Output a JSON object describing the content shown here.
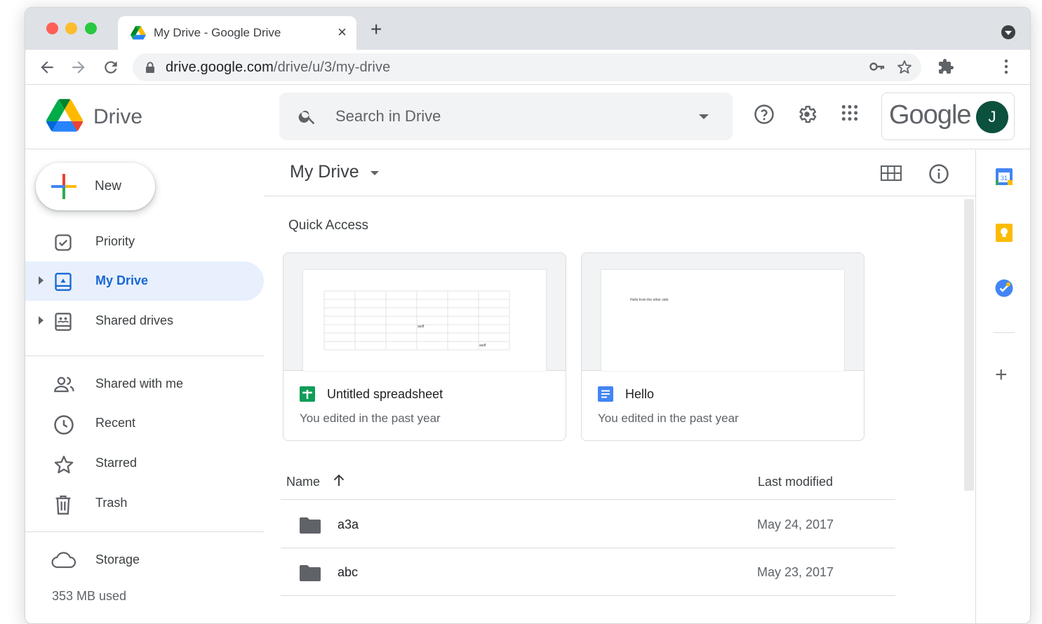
{
  "browser": {
    "tab_title": "My Drive - Google Drive",
    "url_host": "drive.google.com",
    "url_path": "/drive/u/3/my-drive"
  },
  "header": {
    "app_name": "Drive",
    "search_placeholder": "Search in Drive",
    "brand": "Google",
    "avatar_initial": "J"
  },
  "sidebar": {
    "new_label": "New",
    "items": [
      {
        "label": "Priority",
        "icon": "priority-icon"
      },
      {
        "label": "My Drive",
        "icon": "my-drive-icon",
        "active": true
      },
      {
        "label": "Shared drives",
        "icon": "shared-drives-icon"
      },
      {
        "label": "Shared with me",
        "icon": "shared-with-me-icon"
      },
      {
        "label": "Recent",
        "icon": "clock-icon"
      },
      {
        "label": "Starred",
        "icon": "star-icon"
      },
      {
        "label": "Trash",
        "icon": "trash-icon"
      },
      {
        "label": "Storage",
        "icon": "cloud-icon"
      }
    ],
    "storage_used": "353 MB used"
  },
  "main": {
    "title": "My Drive",
    "quick_access_title": "Quick Access",
    "cards": [
      {
        "name": "Untitled spreadsheet",
        "subtitle": "You edited in the past year",
        "type": "sheets",
        "preview_cells": [
          "asdf",
          "asdf"
        ]
      },
      {
        "name": "Hello",
        "subtitle": "You edited in the past year",
        "type": "docs",
        "preview_text": "Hello from the other side"
      }
    ],
    "columns": {
      "name": "Name",
      "modified": "Last modified"
    },
    "rows": [
      {
        "name": "a3a",
        "modified": "May 24, 2017"
      },
      {
        "name": "abc",
        "modified": "May 23, 2017"
      }
    ]
  },
  "side_panel": {
    "calendar_day": "31"
  },
  "colors": {
    "accent_blue": "#1a73e8",
    "active_bg": "#e8f0fe",
    "sheets_green": "#0f9d58",
    "docs_blue": "#4285f4",
    "avatar_bg": "#0b513e"
  }
}
